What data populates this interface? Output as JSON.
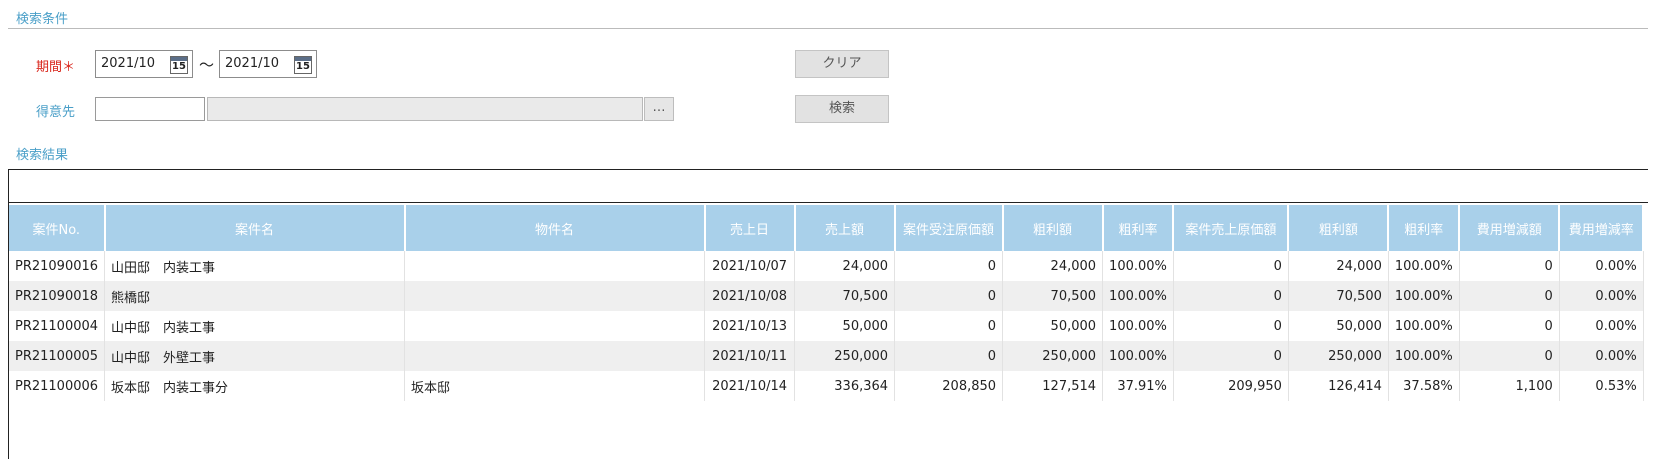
{
  "search": {
    "section_title": "検索条件",
    "period_label": "期間＊",
    "period_from": "2021/10",
    "period_to": "2021/10",
    "period_sep": "～",
    "calendar_day": "15",
    "customer_label": "得意先",
    "customer_code": "",
    "customer_name": "",
    "lookup_label": "…",
    "clear_label": "クリア",
    "search_label": "検索"
  },
  "results": {
    "section_title": "検索結果",
    "columns": [
      "案件No.",
      "案件名",
      "物件名",
      "売上日",
      "売上額",
      "案件受注原価額",
      "粗利額",
      "粗利率",
      "案件売上原価額",
      "粗利額",
      "粗利率",
      "費用増減額",
      "費用増減率"
    ],
    "rows": [
      [
        "PR21090016",
        "山田邸　内装工事",
        "",
        "2021/10/07",
        "24,000",
        "0",
        "24,000",
        "100.00%",
        "0",
        "24,000",
        "100.00%",
        "0",
        "0.00%"
      ],
      [
        "PR21090018",
        "熊橋邸",
        "",
        "2021/10/08",
        "70,500",
        "0",
        "70,500",
        "100.00%",
        "0",
        "70,500",
        "100.00%",
        "0",
        "0.00%"
      ],
      [
        "PR21100004",
        "山中邸　内装工事",
        "",
        "2021/10/13",
        "50,000",
        "0",
        "50,000",
        "100.00%",
        "0",
        "50,000",
        "100.00%",
        "0",
        "0.00%"
      ],
      [
        "PR21100005",
        "山中邸　外壁工事",
        "",
        "2021/10/11",
        "250,000",
        "0",
        "250,000",
        "100.00%",
        "0",
        "250,000",
        "100.00%",
        "0",
        "0.00%"
      ],
      [
        "PR21100006",
        "坂本邸　内装工事分",
        "坂本邸",
        "2021/10/14",
        "336,364",
        "208,850",
        "127,514",
        "37.91%",
        "209,950",
        "126,414",
        "37.58%",
        "1,100",
        "0.53%"
      ]
    ]
  },
  "colors": {
    "accent": "#4a9fc8",
    "required": "#d9261c",
    "header_bg": "#a9d0ea"
  }
}
